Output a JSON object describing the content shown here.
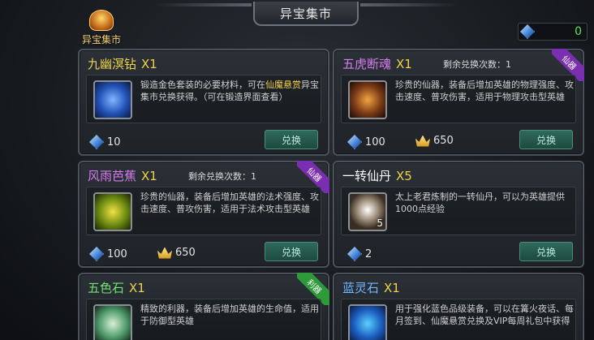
{
  "title": "异宝集市",
  "logo_label": "异宝集市",
  "currency": {
    "icon": "gem-icon",
    "value": "0"
  },
  "cards": [
    {
      "name": "九幽溟钻",
      "name_color": "#f1d34a",
      "qty": "X1",
      "exchange_left": "",
      "desc_before": "锻造金色套装的必要材料，可在",
      "desc_highlight": "仙魔悬赏",
      "desc_after": "异宝集市兑换获得。（可在锻造界面查看）",
      "icon": "crystal-icon",
      "icon_num": "",
      "price_gem": "10",
      "price_crown": "",
      "button": "兑换",
      "ribbon": ""
    },
    {
      "name": "五虎断魂",
      "name_color": "#d77cf0",
      "qty": "X1",
      "exchange_left": "剩余兑换次数：1",
      "desc_before": "珍贵的仙器，装备后增加英雄的物理强度、攻击速度、普攻伤害，适用于物理攻击型英雄",
      "desc_highlight": "",
      "desc_after": "",
      "icon": "sword-icon",
      "icon_num": "",
      "price_gem": "100",
      "price_crown": "650",
      "button": "兑换",
      "ribbon": "仙器"
    },
    {
      "name": "风雨芭蕉",
      "name_color": "#d77cf0",
      "qty": "X1",
      "exchange_left": "剩余兑换次数：1",
      "desc_before": "珍贵的仙器，装备后增加英雄的法术强度、攻击速度、普攻伤害，适用于法术攻击型英雄",
      "desc_highlight": "",
      "desc_after": "",
      "icon": "fan-icon",
      "icon_num": "",
      "price_gem": "100",
      "price_crown": "650",
      "button": "兑换",
      "ribbon": "仙器"
    },
    {
      "name": "一转仙丹",
      "name_color": "#ffffff",
      "qty": "X5",
      "exchange_left": "",
      "desc_before": "太上老君炼制的一转仙丹，可以为英雄提供1000点经验",
      "desc_highlight": "",
      "desc_after": "",
      "icon": "pill-icon",
      "icon_num": "5",
      "price_gem": "2",
      "price_crown": "",
      "button": "兑换",
      "ribbon": ""
    },
    {
      "name": "五色石",
      "name_color": "#6fe36f",
      "qty": "X1",
      "exchange_left": "",
      "desc_before": "精致的利器，装备后增加英雄的生命值，适用于防御型英雄",
      "desc_highlight": "",
      "desc_after": "",
      "icon": "stone-icon",
      "icon_num": "",
      "price_gem": "",
      "price_crown": "",
      "button": "",
      "ribbon": "利器"
    },
    {
      "name": "蓝灵石",
      "name_color": "#6fb8ff",
      "qty": "X1",
      "exchange_left": "",
      "desc_before": "用于强化蓝色品级装备，可以在篝火夜话、每月签到、仙魔悬赏兑换及VIP每周礼包中获得",
      "desc_highlight": "",
      "desc_after": "",
      "icon": "blue-gem-icon",
      "icon_num": "",
      "price_gem": "",
      "price_crown": "",
      "button": "",
      "ribbon": ""
    }
  ]
}
